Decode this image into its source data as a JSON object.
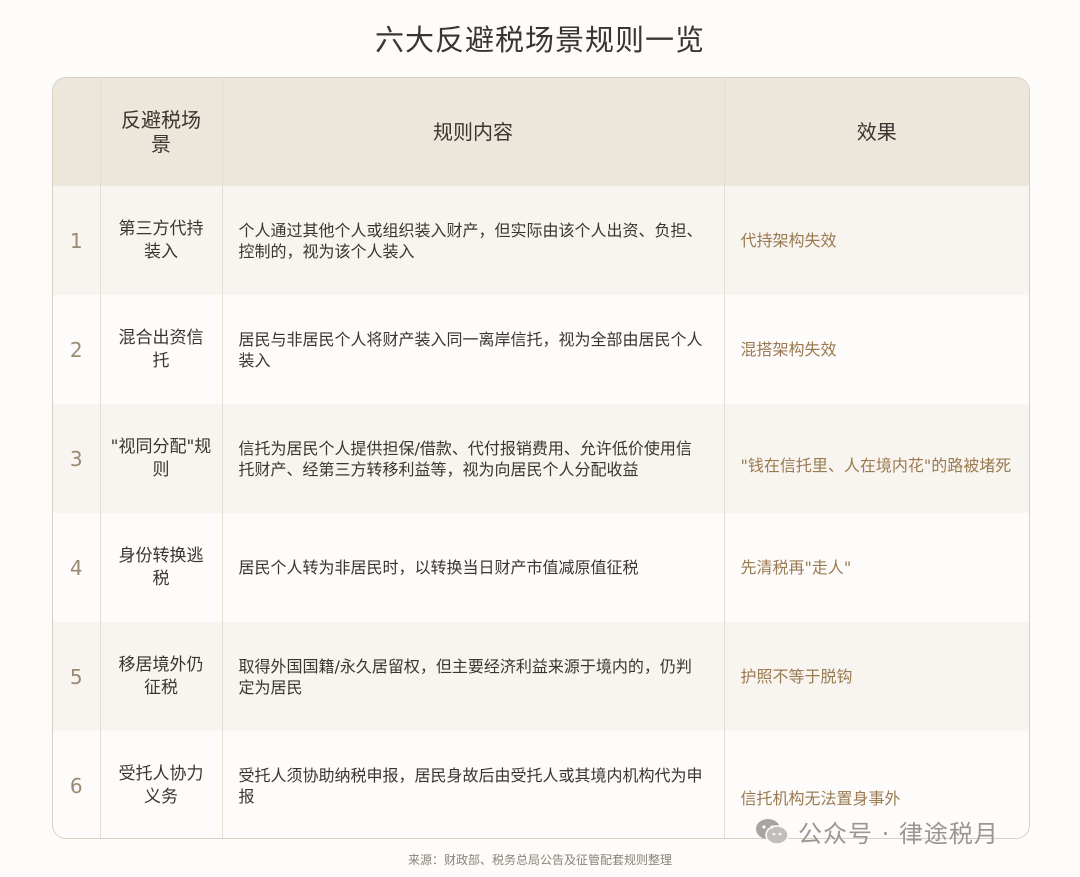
{
  "title": "六大反避税场景规则一览",
  "table": {
    "headers": {
      "num": "",
      "scene": "反避税场景",
      "rule": "规则内容",
      "effect": "效果"
    },
    "rows": [
      {
        "num": "1",
        "scene": "第三方代持装入",
        "rule": "个人通过其他个人或组织装入财产，但实际由该个人出资、负担、控制的，视为该个人装入",
        "effect": "代持架构失效"
      },
      {
        "num": "2",
        "scene": "混合出资信托",
        "rule": "居民与非居民个人将财产装入同一离岸信托，视为全部由居民个人装入",
        "effect": "混搭架构失效"
      },
      {
        "num": "3",
        "scene": "\"视同分配\"规则",
        "rule": "信托为居民个人提供担保/借款、代付报销费用、允许低价使用信托财产、经第三方转移利益等，视为向居民个人分配收益",
        "effect": "\"钱在信托里、人在境内花\"的路被堵死"
      },
      {
        "num": "4",
        "scene": "身份转换逃税",
        "rule": "居民个人转为非居民时，以转换当日财产市值减原值征税",
        "effect": "先清税再\"走人\""
      },
      {
        "num": "5",
        "scene": "移居境外仍征税",
        "rule": "取得外国国籍/永久居留权，但主要经济利益来源于境内的，仍判定为居民",
        "effect": "护照不等于脱钩"
      },
      {
        "num": "6",
        "scene": "受托人协力义务",
        "rule": "受托人须协助纳税申报，居民身故后由受托人或其境内机构代为申报",
        "effect": "信托机构无法置身事外"
      }
    ]
  },
  "source": "来源：财政部、税务总局公告及征管配套规则整理",
  "watermark": {
    "text": "公众号 · 律途税月",
    "icon": "wechat-icon"
  }
}
